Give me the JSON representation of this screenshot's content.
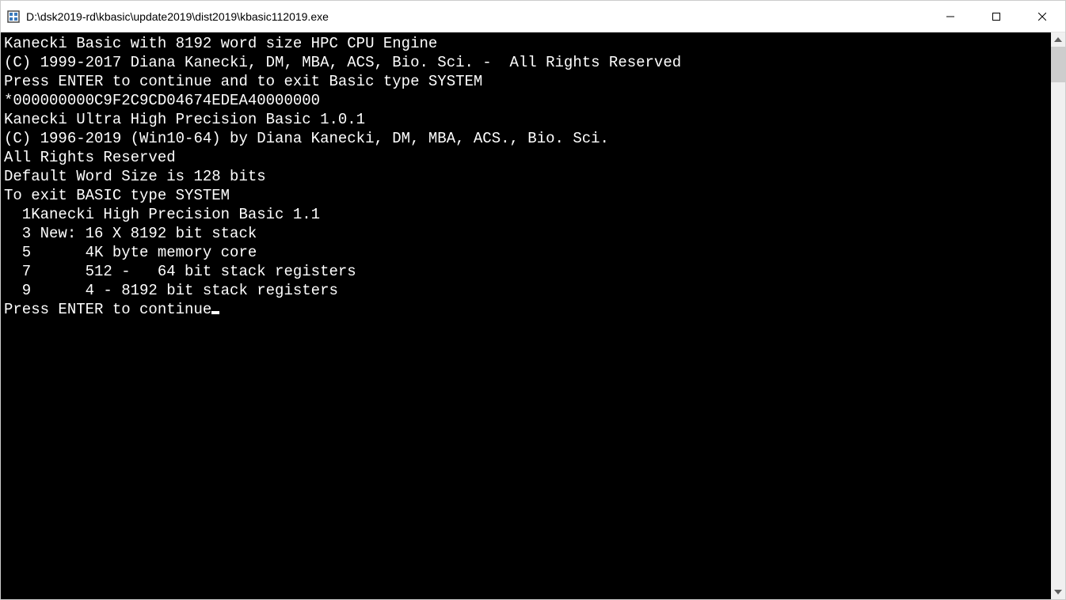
{
  "titlebar": {
    "title": "D:\\dsk2019-rd\\kbasic\\update2019\\dist2019\\kbasic112019.exe"
  },
  "console": {
    "lines": [
      "Kanecki Basic with 8192 word size HPC CPU Engine",
      "(C) 1999-2017 Diana Kanecki, DM, MBA, ACS, Bio. Sci. -  All Rights Reserved",
      "",
      "Press ENTER to continue and to exit Basic type SYSTEM",
      "",
      "*000000000C9F2C9CD04674EDEA40000000",
      "",
      "Kanecki Ultra High Precision Basic 1.0.1",
      "(C) 1996-2019 (Win10-64) by Diana Kanecki, DM, MBA, ACS., Bio. Sci.",
      "All Rights Reserved",
      "Default Word Size is 128 bits",
      "To exit BASIC type SYSTEM",
      "",
      "  1Kanecki High Precision Basic 1.1",
      "  3 New: 16 X 8192 bit stack",
      "  5      4K byte memory core",
      "  7      512 -   64 bit stack registers",
      "  9      4 - 8192 bit stack registers"
    ],
    "prompt": "Press ENTER to continue"
  }
}
